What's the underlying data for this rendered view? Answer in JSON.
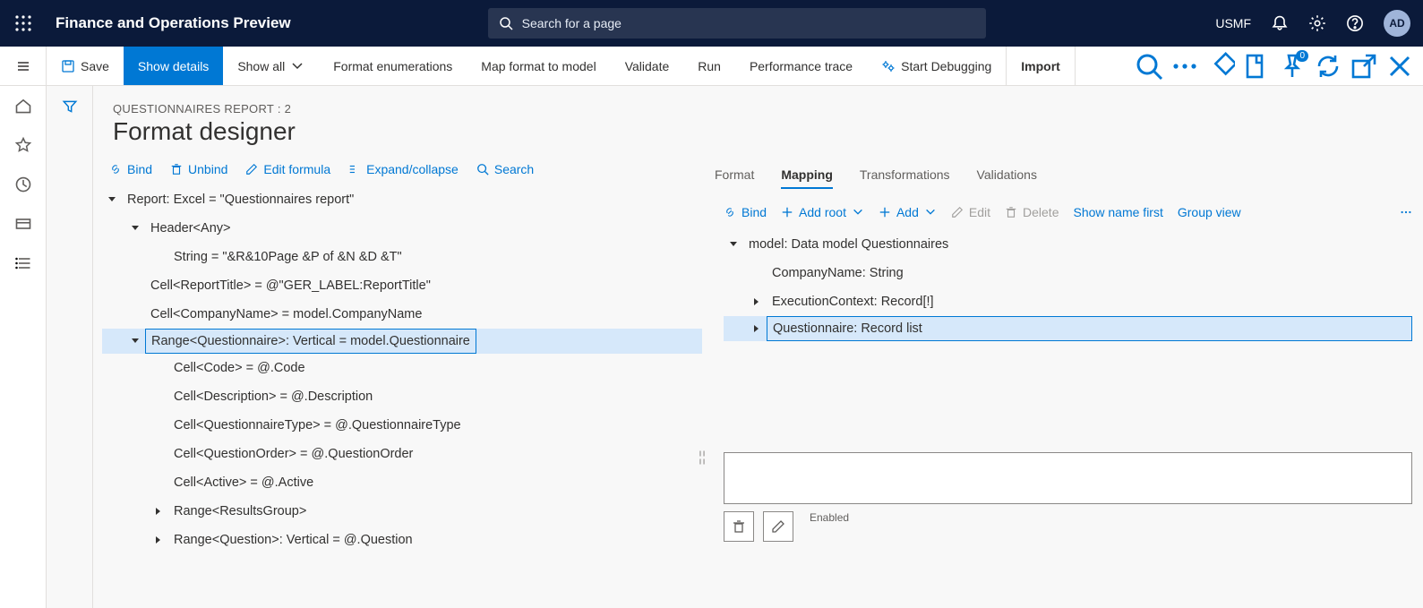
{
  "topnav": {
    "brand": "Finance and Operations Preview",
    "search_placeholder": "Search for a page",
    "company": "USMF",
    "avatar": "AD"
  },
  "actionbar": {
    "save": "Save",
    "show_details": "Show details",
    "show_all": "Show all",
    "format_enum": "Format enumerations",
    "map_format": "Map format to model",
    "validate": "Validate",
    "run": "Run",
    "perf_trace": "Performance trace",
    "start_debug": "Start Debugging",
    "import": "Import",
    "badge_count": "0"
  },
  "page": {
    "breadcrumb": "QUESTIONNAIRES REPORT : 2",
    "title": "Format designer"
  },
  "left_toolbar": {
    "bind": "Bind",
    "unbind": "Unbind",
    "edit_formula": "Edit formula",
    "expand": "Expand/collapse",
    "search": "Search"
  },
  "format_tree": [
    {
      "depth": 0,
      "tw": "down",
      "label": "Report: Excel = \"Questionnaires report\""
    },
    {
      "depth": 1,
      "tw": "down",
      "label": "Header<Any>"
    },
    {
      "depth": 2,
      "tw": "none",
      "label": "String = \"&R&10Page &P of &N &D &T\""
    },
    {
      "depth": 1,
      "tw": "none",
      "label": "Cell<ReportTitle> = @\"GER_LABEL:ReportTitle\""
    },
    {
      "depth": 1,
      "tw": "none",
      "label": "Cell<CompanyName> = model.CompanyName"
    },
    {
      "depth": 1,
      "tw": "down",
      "label": "Range<Questionnaire>: Vertical = model.Questionnaire",
      "selected": true
    },
    {
      "depth": 2,
      "tw": "none",
      "label": "Cell<Code> = @.Code"
    },
    {
      "depth": 2,
      "tw": "none",
      "label": "Cell<Description> = @.Description"
    },
    {
      "depth": 2,
      "tw": "none",
      "label": "Cell<QuestionnaireType> = @.QuestionnaireType"
    },
    {
      "depth": 2,
      "tw": "none",
      "label": "Cell<QuestionOrder> = @.QuestionOrder"
    },
    {
      "depth": 2,
      "tw": "none",
      "label": "Cell<Active> = @.Active"
    },
    {
      "depth": 2,
      "tw": "right",
      "label": "Range<ResultsGroup>"
    },
    {
      "depth": 2,
      "tw": "right",
      "label": "Range<Question>: Vertical = @.Question"
    }
  ],
  "tabs": {
    "format": "Format",
    "mapping": "Mapping",
    "transformations": "Transformations",
    "validations": "Validations"
  },
  "right_toolbar": {
    "bind": "Bind",
    "add_root": "Add root",
    "add": "Add",
    "edit": "Edit",
    "delete": "Delete",
    "show_name": "Show name first",
    "group_view": "Group view"
  },
  "mapping_tree": [
    {
      "depth": 0,
      "tw": "down",
      "label": "model: Data model Questionnaires"
    },
    {
      "depth": 1,
      "tw": "none",
      "label": "CompanyName: String"
    },
    {
      "depth": 1,
      "tw": "right",
      "label": "ExecutionContext: Record[!]"
    },
    {
      "depth": 1,
      "tw": "right",
      "label": "Questionnaire: Record list",
      "selected": true
    }
  ],
  "formula": {
    "enabled_label": "Enabled"
  }
}
